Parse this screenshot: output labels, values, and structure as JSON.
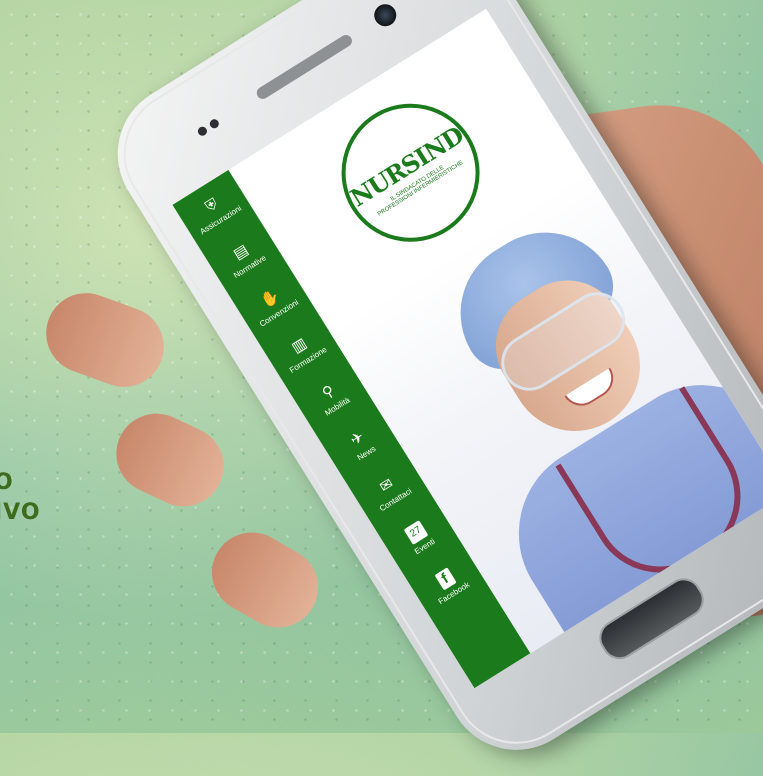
{
  "background_text": [
    "O",
    "IVO"
  ],
  "app": {
    "brand_color": "#1b7a1b",
    "logo": {
      "name": "NURSIND",
      "tagline": "IL SINDACATO DELLE PROFESSIONI INFERMIERISTICHE"
    },
    "menu": [
      {
        "label": "Assicurazioni",
        "icon": "shield-icon"
      },
      {
        "label": "Normative",
        "icon": "clipboard-icon"
      },
      {
        "label": "Convenzioni",
        "icon": "handshake-icon"
      },
      {
        "label": "Formazione",
        "icon": "book-icon"
      },
      {
        "label": "Mobilità",
        "icon": "magnifier-icon"
      },
      {
        "label": "News",
        "icon": "bird-icon"
      },
      {
        "label": "Contattaci",
        "icon": "envelope-icon"
      },
      {
        "label": "Eventi",
        "icon": "calendar-icon",
        "badge": "27"
      },
      {
        "label": "Facebook",
        "icon": "facebook-icon"
      }
    ]
  }
}
